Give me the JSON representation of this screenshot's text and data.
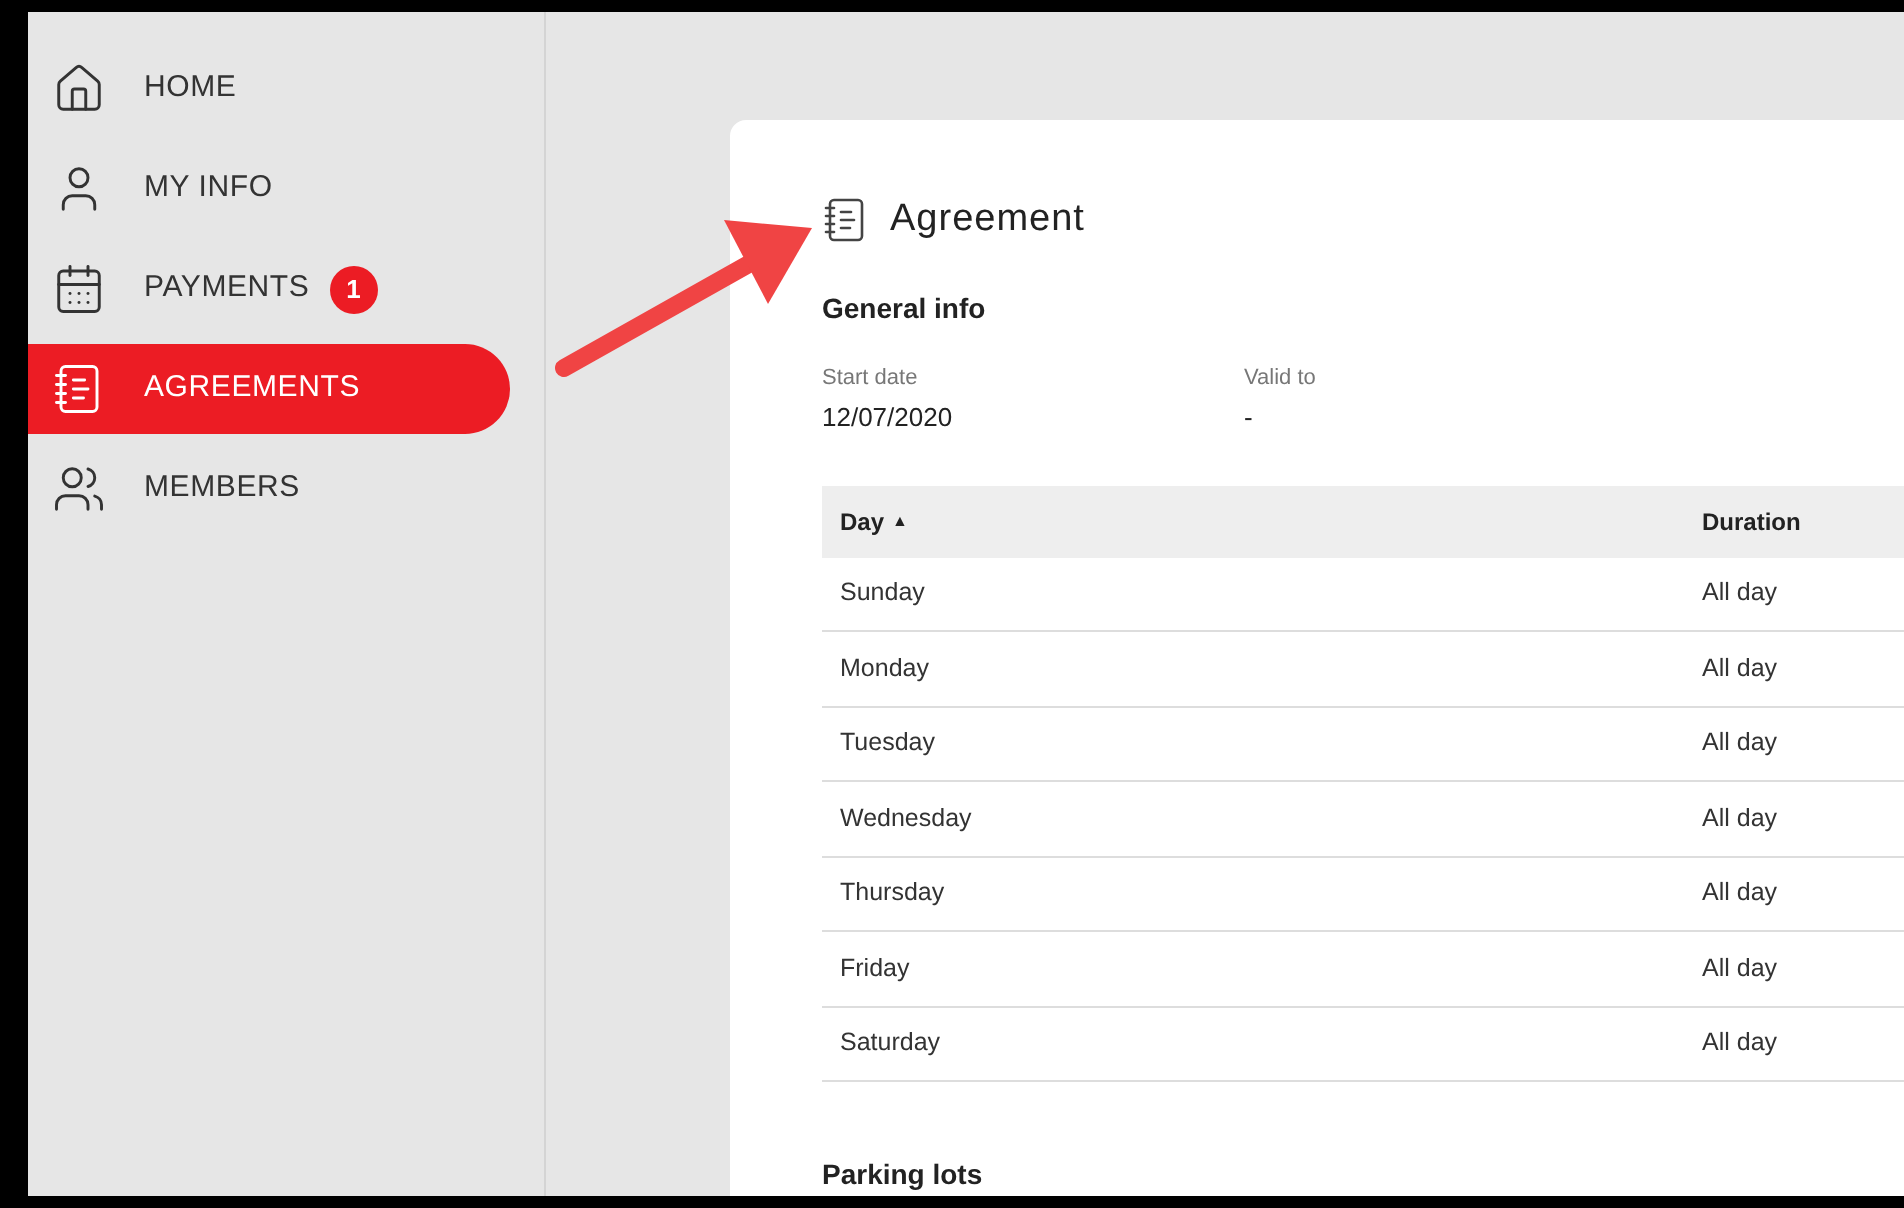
{
  "sidebar": {
    "items": [
      {
        "label": "HOME",
        "kind": "home",
        "selected": false
      },
      {
        "label": "MY INFO",
        "kind": "user",
        "selected": false
      },
      {
        "label": "PAYMENTS",
        "kind": "calendar",
        "selected": false,
        "badge": "1"
      },
      {
        "label": "AGREEMENTS",
        "kind": "notepad",
        "selected": true
      },
      {
        "label": "MEMBERS",
        "kind": "users",
        "selected": false
      }
    ]
  },
  "page": {
    "title": "Agreement",
    "section": "General info",
    "fields": [
      {
        "label": "Start date",
        "value": "12/07/2020"
      },
      {
        "label": "Valid to",
        "value": "-"
      }
    ],
    "table": {
      "columns": [
        {
          "label": "Day",
          "sort_mark": "▲"
        },
        {
          "label": "Duration"
        }
      ],
      "rows": [
        [
          "Sunday",
          "All day"
        ],
        [
          "Monday",
          "All day"
        ],
        [
          "Tuesday",
          "All day"
        ],
        [
          "Wednesday",
          "All day"
        ],
        [
          "Thursday",
          "All day"
        ],
        [
          "Friday",
          "All day"
        ],
        [
          "Saturday",
          "All day"
        ]
      ]
    },
    "next_section": "Parking lots"
  }
}
